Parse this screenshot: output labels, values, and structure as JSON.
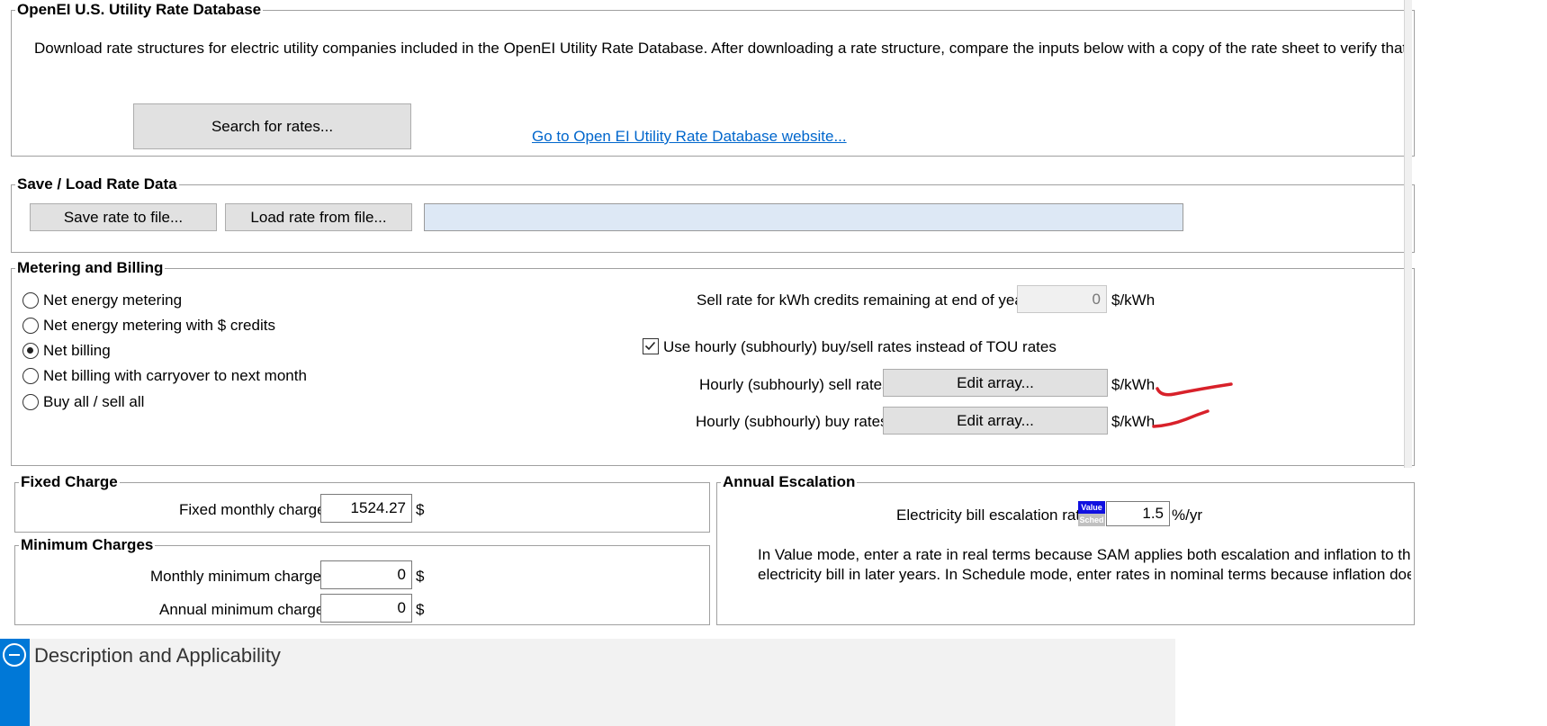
{
  "openei": {
    "title": "OpenEI U.S. Utility Rate Database",
    "description": "Download rate structures for electric utility companies included in the OpenEI Utility Rate Database. After downloading a rate structure, compare the inputs below with a copy of the rate sheet to verify that the info",
    "search_button": "Search for rates...",
    "website_link": "Go to Open EI Utility Rate Database website..."
  },
  "save_load": {
    "title": "Save / Load Rate Data",
    "save_button": "Save rate to file...",
    "load_button": "Load rate from file...",
    "file_path": ""
  },
  "metering": {
    "title": "Metering and Billing",
    "options": [
      {
        "label": "Net energy metering",
        "selected": false
      },
      {
        "label": "Net energy metering with $ credits",
        "selected": false
      },
      {
        "label": "Net billing",
        "selected": true
      },
      {
        "label": "Net billing with carryover to next month",
        "selected": false
      },
      {
        "label": "Buy all / sell all",
        "selected": false
      }
    ],
    "sell_rate_label": "Sell rate for kWh credits remaining at end of year",
    "sell_rate_value": "0",
    "sell_rate_unit": "$/kWh",
    "hourly_checkbox_label": "Use hourly (subhourly) buy/sell rates instead of TOU rates",
    "hourly_checked": true,
    "sell_rates_label": "Hourly (subhourly) sell rates",
    "buy_rates_label": "Hourly (subhourly) buy rates",
    "edit_array_label": "Edit array...",
    "rate_unit": "$/kWh"
  },
  "fixed_charge": {
    "title": "Fixed Charge",
    "monthly_label": "Fixed monthly charge",
    "monthly_value": "1524.27",
    "unit": "$"
  },
  "minimum_charges": {
    "title": "Minimum Charges",
    "monthly_label": "Monthly minimum charge",
    "monthly_value": "0",
    "annual_label": "Annual minimum charge",
    "annual_value": "0",
    "unit": "$"
  },
  "escalation": {
    "title": "Annual Escalation",
    "rate_label": "Electricity bill escalation rate",
    "value_toggle": "Value",
    "sched_toggle": "Sched",
    "rate_value": "1.5",
    "unit": "%/yr",
    "note_line1": "In Value mode, enter a rate in real terms because SAM applies both escalation and inflation to the to",
    "note_line2": "electricity bill in later years. In Schedule mode, enter rates in nominal terms because inflation does no"
  },
  "description_section": {
    "title": "Description and Applicability"
  },
  "colors": {
    "accent_blue": "#0078d7",
    "link": "#0066cc",
    "annotation_red": "#d8212a",
    "file_field_bg": "#dde8f5"
  }
}
